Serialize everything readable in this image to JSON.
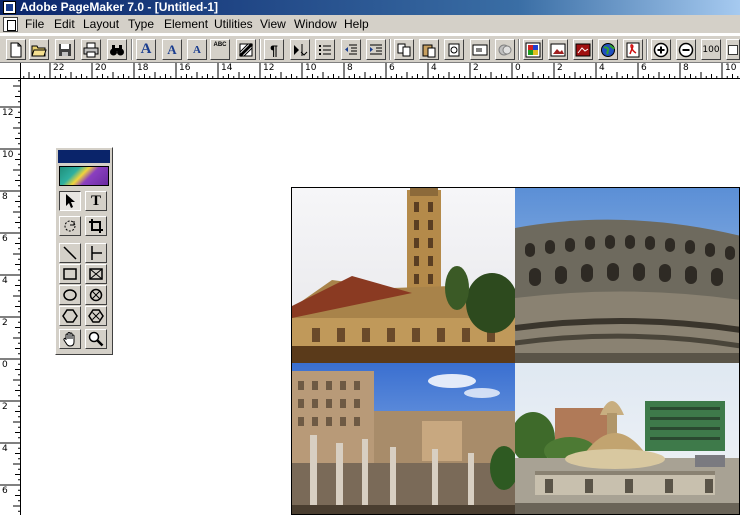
{
  "window": {
    "title": "Adobe PageMaker 7.0 - [Untitled-1]"
  },
  "menu": [
    {
      "label": "File"
    },
    {
      "label": "Edit"
    },
    {
      "label": "Layout"
    },
    {
      "label": "Type"
    },
    {
      "label": "Element"
    },
    {
      "label": "Utilities"
    },
    {
      "label": "View"
    },
    {
      "label": "Window"
    },
    {
      "label": "Help"
    }
  ],
  "toolbar": {
    "buttons": [
      {
        "icon": "new-document-icon"
      },
      {
        "icon": "open-folder-icon"
      },
      {
        "icon": "save-icon"
      },
      {
        "icon": "print-icon"
      },
      {
        "icon": "find-binoculars-icon"
      },
      {
        "icon": "character-font-icon",
        "glyph": "A"
      },
      {
        "icon": "increase-font-size-icon",
        "glyph": "A"
      },
      {
        "icon": "decrease-font-size-icon",
        "glyph": "A"
      },
      {
        "icon": "spelling-check-icon",
        "glyph": "ABC"
      },
      {
        "icon": "fill-stroke-icon"
      },
      {
        "icon": "paragraph-icon",
        "glyph": "¶"
      },
      {
        "icon": "indents-tabs-icon"
      },
      {
        "icon": "bullets-icon"
      },
      {
        "icon": "decrease-indent-icon"
      },
      {
        "icon": "increase-indent-icon"
      },
      {
        "icon": "copy-icon"
      },
      {
        "icon": "paste-icon"
      },
      {
        "icon": "links-manager-icon"
      },
      {
        "icon": "place-icon"
      },
      {
        "icon": "library-icon"
      },
      {
        "icon": "colors-palette-icon"
      },
      {
        "icon": "image-control-icon"
      },
      {
        "icon": "photoshop-icon"
      },
      {
        "icon": "web-globe-icon"
      },
      {
        "icon": "export-pdf-icon"
      },
      {
        "icon": "zoom-in-icon"
      },
      {
        "icon": "zoom-out-icon"
      },
      {
        "icon": "actual-size-icon",
        "glyph": "100"
      },
      {
        "icon": "fit-window-icon"
      }
    ]
  },
  "rulers": {
    "horizontal_labels": [
      "22",
      "20",
      "18",
      "16",
      "14",
      "12",
      "10",
      "8",
      "6",
      "4",
      "2",
      "0",
      "2",
      "4",
      "6",
      "8",
      "10"
    ],
    "vertical_labels": [
      "12",
      "10",
      "8",
      "6",
      "4",
      "2",
      "0",
      "2",
      "4",
      "6"
    ]
  },
  "toolbox": {
    "tools": [
      {
        "name": "pointer-tool",
        "active": true
      },
      {
        "name": "text-tool",
        "glyph": "T"
      },
      {
        "name": "rotate-tool"
      },
      {
        "name": "crop-tool"
      },
      {
        "name": "line-tool"
      },
      {
        "name": "constrained-line-tool"
      },
      {
        "name": "rectangle-tool"
      },
      {
        "name": "rectangle-frame-tool"
      },
      {
        "name": "ellipse-tool"
      },
      {
        "name": "ellipse-frame-tool"
      },
      {
        "name": "polygon-tool"
      },
      {
        "name": "polygon-frame-tool"
      },
      {
        "name": "hand-tool"
      },
      {
        "name": "zoom-tool"
      }
    ]
  },
  "page": {
    "photos": [
      {
        "subject": "bell-tower-church"
      },
      {
        "subject": "colosseum-interior"
      },
      {
        "subject": "forum-ruins-columns"
      },
      {
        "subject": "fountain-piazza"
      }
    ]
  },
  "colors": {
    "titlebar_start": "#0a246a",
    "titlebar_end": "#a6caf0",
    "chrome": "#d4d0c8"
  }
}
